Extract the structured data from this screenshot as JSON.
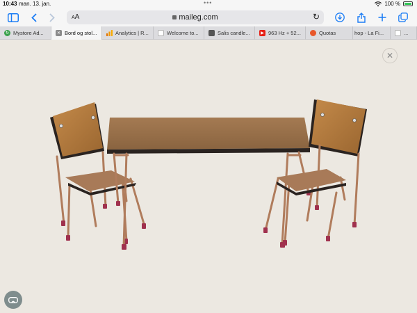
{
  "status": {
    "time": "10:43",
    "date": "man. 13. jan.",
    "battery": "100 %"
  },
  "toolbar": {
    "text_size": "AA",
    "url": "maileg.com"
  },
  "tabs": [
    {
      "label": "Mystore Ad...",
      "favicon": "green-refresh-icon",
      "color": "#3aa14b"
    },
    {
      "label": "Bord og stol...",
      "favicon": "close-icon",
      "color": "#8a8a8a",
      "active": true
    },
    {
      "label": "Analytics | R...",
      "favicon": "analytics-icon",
      "color": "#f29900"
    },
    {
      "label": "Welcome to...",
      "favicon": "page-icon",
      "color": "#b0b0b0"
    },
    {
      "label": "Salis candle...",
      "favicon": "image-icon",
      "color": "#555555"
    },
    {
      "label": "963 Hz + 52...",
      "favicon": "youtube-icon",
      "color": "#e62117"
    },
    {
      "label": "Quotas",
      "favicon": "quotas-icon",
      "color": "#e8572a"
    },
    {
      "label": "hop - La Fi...",
      "favicon": "",
      "color": "#000000"
    },
    {
      "label": "...",
      "favicon": "page-icon",
      "color": "#b0b0b0"
    }
  ],
  "content": {
    "product": "table-and-two-chairs-image"
  },
  "colors": {
    "accent": "#1a7cf5",
    "background": "#ece8e1"
  }
}
